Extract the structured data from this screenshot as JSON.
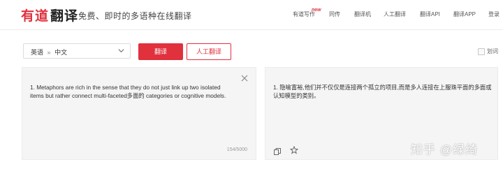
{
  "header": {
    "logo_youdao": "有道",
    "logo_fanyi": "翻译",
    "slogan": "免费、即时的多语种在线翻译",
    "new_tag": "new",
    "nav": [
      "有道写作",
      "同传",
      "翻译机",
      "人工翻译",
      "翻译API",
      "翻译APP",
      "登录"
    ]
  },
  "toolbar": {
    "lang_from": "英语",
    "lang_arrow": "»",
    "lang_to": "中文",
    "translate_button": "翻译",
    "human_translate_button": "人工翻译",
    "dict_label": "划词"
  },
  "source": {
    "text": "1. Metaphors are rich in the sense that they do not just link up two isolated items but rather connect multi-faceted多面的 categories or cognitive models.",
    "counter": "154/5000"
  },
  "result": {
    "text": "1. 隐喻富裕,他们并不仅仅是连接两个孤立的项目,而是多人连接在上服珠平面的多面或认知模型的类别。"
  },
  "watermark": "知乎 @绿绮",
  "colors": {
    "brand_red": "#e0313d",
    "panel_bg": "#f5f5f5"
  },
  "icons": {
    "close": "close-icon",
    "copy": "copy-icon",
    "star": "star-icon",
    "chevron": "chevron-down-icon"
  }
}
